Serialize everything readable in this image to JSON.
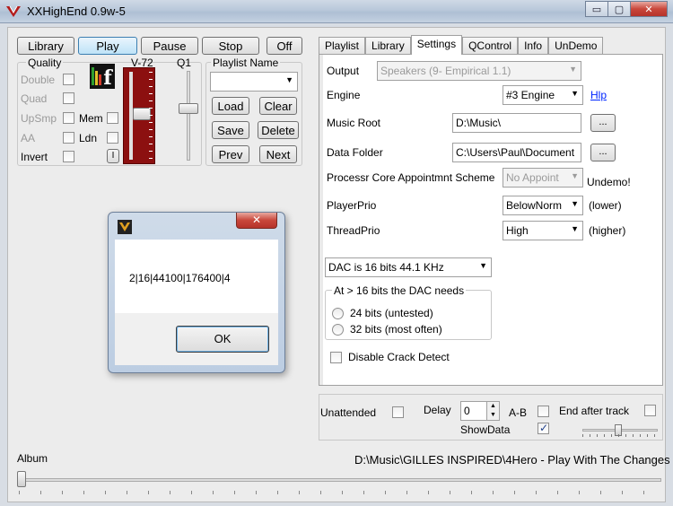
{
  "window": {
    "title": "XXHighEnd 0.9w-5",
    "controls": {
      "minimize": "▭",
      "maximize": "▢",
      "close": "✕"
    }
  },
  "transport": {
    "library": "Library",
    "play": "Play",
    "pause": "Pause",
    "stop": "Stop",
    "off": "Off"
  },
  "quality": {
    "title": "Quality",
    "double": "Double",
    "quad": "Quad",
    "upsmp": "UpSmp",
    "aa": "AA",
    "invert": "Invert",
    "mem": "Mem",
    "ldn": "Ldn",
    "info_btn": "I"
  },
  "meter": {
    "label": "V-72",
    "level_fraction": 0.45
  },
  "q1": {
    "label": "Q1",
    "level_fraction": 0.4
  },
  "playlist": {
    "name_label": "Playlist Name",
    "name_value": "",
    "load": "Load",
    "clear": "Clear",
    "save": "Save",
    "delete": "Delete",
    "prev": "Prev",
    "next": "Next"
  },
  "tabs": [
    "Playlist",
    "Library",
    "Settings",
    "QControl",
    "Info",
    "UnDemo"
  ],
  "active_tab": "Settings",
  "settings": {
    "output_label": "Output",
    "output_value": "Speakers (9- Empirical 1.1)",
    "engine_label": "Engine",
    "engine_value": "#3 Engine",
    "help_link": "Hlp",
    "music_root_label": "Music Root",
    "music_root_value": "D:\\Music\\",
    "data_folder_label": "Data Folder",
    "data_folder_value": "C:\\Users\\Paul\\Document",
    "browse_label": "...",
    "core_label": "Processr Core Appointmnt Scheme",
    "core_value": "No Appoint",
    "undemo": "Undemo!",
    "player_prio_label": "PlayerPrio",
    "player_prio_value": "BelowNorm",
    "player_prio_note": "(lower)",
    "thread_prio_label": "ThreadPrio",
    "thread_prio_value": "High",
    "thread_prio_note": "(higher)",
    "dac_value": "DAC is 16 bits   44.1 KHz",
    "dac_group_title": "At > 16 bits the DAC needs",
    "radio_24": "24 bits (untested)",
    "radio_32": "32 bits (most often)",
    "disable_crack": "Disable Crack Detect"
  },
  "bottom": {
    "unattended": "Unattended",
    "delay_label": "Delay",
    "delay_value": "0",
    "ab": "A-B",
    "end_after_track": "End after track",
    "showdata": "ShowData",
    "showdata_checked": true
  },
  "album": {
    "label": "Album",
    "track_info": "D:\\Music\\GILLES INSPIRED\\4Hero - Play With The Changes"
  },
  "dialog": {
    "message": "2|16|44100|176400|4",
    "ok": "OK",
    "close": "✕"
  },
  "colors": {
    "meter": "#8c1010",
    "link": "#0026ff",
    "close_red": "#c9473b"
  },
  "icons": {
    "app": "xx-logo-icon",
    "f_logo": "f-meter-logo-icon"
  }
}
